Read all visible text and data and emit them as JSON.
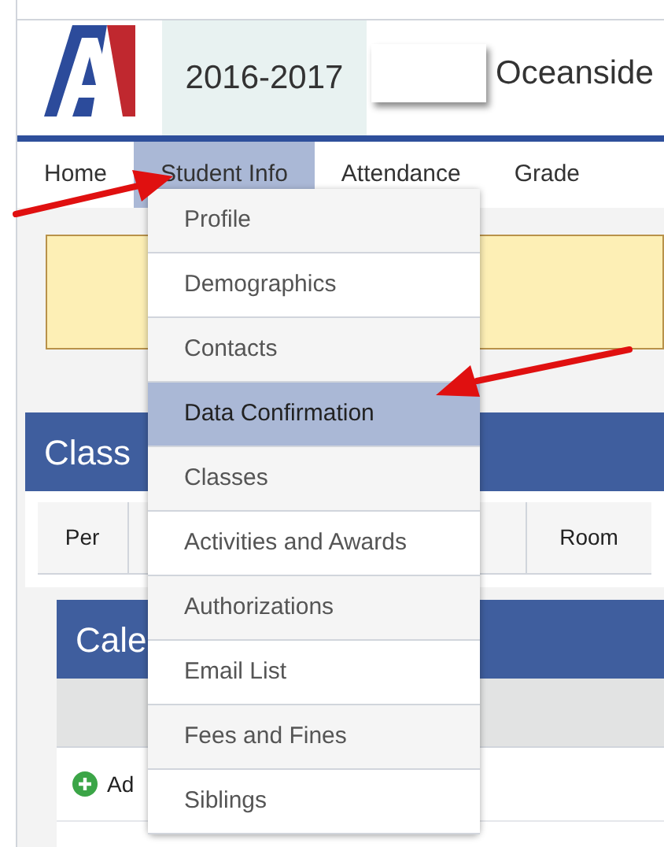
{
  "header": {
    "year": "2016-2017",
    "school": "Oceanside"
  },
  "nav": [
    {
      "label": "Home",
      "selected": false
    },
    {
      "label": "Student Info",
      "selected": true
    },
    {
      "label": "Attendance",
      "selected": false
    },
    {
      "label": "Grade",
      "selected": false
    }
  ],
  "class_panel": {
    "title": "Class",
    "columns": [
      "Per",
      "Room"
    ]
  },
  "calendar_panel": {
    "title": "Cale",
    "add_link": "Ad"
  },
  "menu": [
    {
      "label": "Profile",
      "selected": false
    },
    {
      "label": "Demographics",
      "selected": false
    },
    {
      "label": "Contacts",
      "selected": false
    },
    {
      "label": "Data Confirmation",
      "selected": true
    },
    {
      "label": "Classes",
      "selected": false
    },
    {
      "label": "Activities and Awards",
      "selected": false
    },
    {
      "label": "Authorizations",
      "selected": false
    },
    {
      "label": "Email List",
      "selected": false
    },
    {
      "label": "Fees and Fines",
      "selected": false
    },
    {
      "label": "Siblings",
      "selected": false
    }
  ]
}
